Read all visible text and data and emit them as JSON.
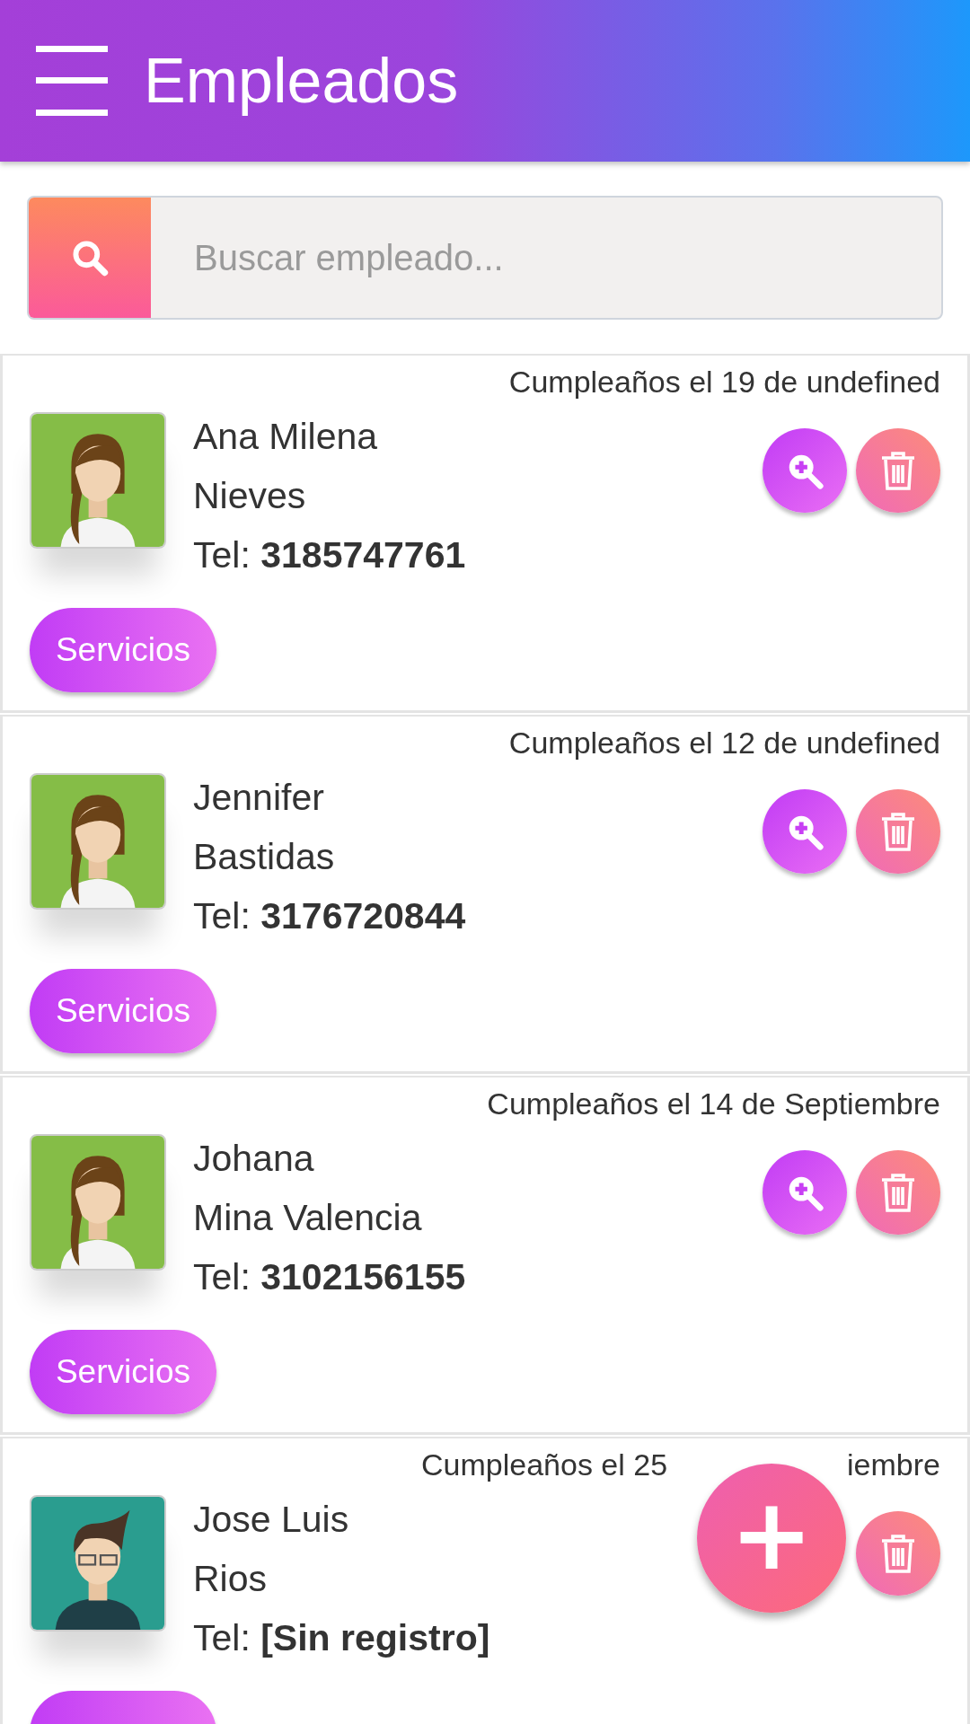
{
  "header": {
    "title": "Empleados"
  },
  "search": {
    "placeholder": "Buscar empleado..."
  },
  "employees": [
    {
      "birthday": "Cumpleaños el 19 de undefined",
      "first_line": "Ana Milena",
      "second_line": "Nieves",
      "tel_label": "Tel:",
      "tel": "3185747761",
      "kind": "woman",
      "actions": [
        {
          "kind": "zoom"
        },
        {
          "kind": "delete"
        }
      ],
      "services_label": "Servicios"
    },
    {
      "birthday": "Cumpleaños el 12 de undefined",
      "first_line": "Jennifer",
      "second_line": "Bastidas",
      "tel_label": "Tel:",
      "tel": "3176720844",
      "kind": "woman",
      "actions": [
        {
          "kind": "zoom"
        },
        {
          "kind": "delete"
        }
      ],
      "services_label": "Servicios"
    },
    {
      "birthday": "Cumpleaños el 14 de Septiembre",
      "first_line": "Johana",
      "second_line": "Mina Valencia",
      "tel_label": "Tel:",
      "tel": "3102156155",
      "kind": "woman",
      "actions": [
        {
          "kind": "zoom"
        },
        {
          "kind": "delete"
        }
      ],
      "services_label": "Servicios"
    },
    {
      "birthday": "Cumpleaños el 25",
      "birthday_tail": "iembre",
      "first_line": "Jose Luis",
      "second_line": "Rios",
      "tel_label": "Tel:",
      "tel": "[Sin registro]",
      "kind": "man",
      "actions": [
        {
          "kind": "delete"
        }
      ]
    }
  ],
  "fab": {
    "label": "+"
  }
}
